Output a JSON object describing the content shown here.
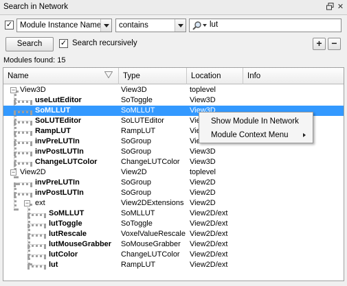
{
  "window": {
    "title": "Search in Network"
  },
  "filter": {
    "attribute_checkbox_checked": true,
    "attribute": "Module Instance Name",
    "operator": "contains",
    "query": "lut"
  },
  "actions": {
    "search_label": "Search",
    "recursive_label": "Search recursively",
    "recursive_checked": true,
    "add_label": "+",
    "remove_label": "−"
  },
  "status": {
    "modules_found": "Modules found: 15"
  },
  "columns": [
    "Name",
    "Type",
    "Location",
    "Info"
  ],
  "rows": [
    {
      "name": "View3D",
      "type": "View3D",
      "location": "toplevel",
      "bold": false,
      "expander": "−"
    },
    {
      "name": "useLutEditor",
      "type": "SoToggle",
      "location": "View3D",
      "bold": true
    },
    {
      "name": "SoMLLUT",
      "type": "SoMLLUT",
      "location": "View3D",
      "bold": true,
      "selected": true
    },
    {
      "name": "SoLUTEditor",
      "type": "SoLUTEditor",
      "location": "Vie",
      "bold": true
    },
    {
      "name": "RampLUT",
      "type": "RampLUT",
      "location": "Vie",
      "bold": true
    },
    {
      "name": "invPreLUTIn",
      "type": "SoGroup",
      "location": "Vie",
      "bold": true
    },
    {
      "name": "invPostLUTIn",
      "type": "SoGroup",
      "location": "View3D",
      "bold": true
    },
    {
      "name": "ChangeLUTColor",
      "type": "ChangeLUTColor",
      "location": "View3D",
      "bold": true
    },
    {
      "name": "View2D",
      "type": "View2D",
      "location": "toplevel",
      "bold": false,
      "expander": "−"
    },
    {
      "name": "invPreLUTIn",
      "type": "SoGroup",
      "location": "View2D",
      "bold": true
    },
    {
      "name": "invPostLUTIn",
      "type": "SoGroup",
      "location": "View2D",
      "bold": true
    },
    {
      "name": "ext",
      "type": "View2DExtensions",
      "location": "View2D",
      "bold": false,
      "expander": "−"
    },
    {
      "name": "SoMLLUT",
      "type": "SoMLLUT",
      "location": "View2D/ext",
      "bold": true
    },
    {
      "name": "lutToggle",
      "type": "SoToggle",
      "location": "View2D/ext",
      "bold": true
    },
    {
      "name": "lutRescale",
      "type": "VoxelValueRescale",
      "location": "View2D/ext",
      "bold": true
    },
    {
      "name": "lutMouseGrabber",
      "type": "SoMouseGrabber",
      "location": "View2D/ext",
      "bold": true
    },
    {
      "name": "lutColor",
      "type": "ChangeLUTColor",
      "location": "View2D/ext",
      "bold": true
    },
    {
      "name": "lut",
      "type": "RampLUT",
      "location": "View2D/ext",
      "bold": true
    }
  ],
  "context_menu": {
    "items": [
      "Show Module In Network",
      "Module Context Menu"
    ]
  },
  "colors": {
    "selection": "#3399ff",
    "window_bg": "#f0f0f0"
  },
  "icons": [
    "float-icon",
    "close-icon",
    "search-icon",
    "sort-indicator-icon",
    "submenu-arrow-icon"
  ]
}
